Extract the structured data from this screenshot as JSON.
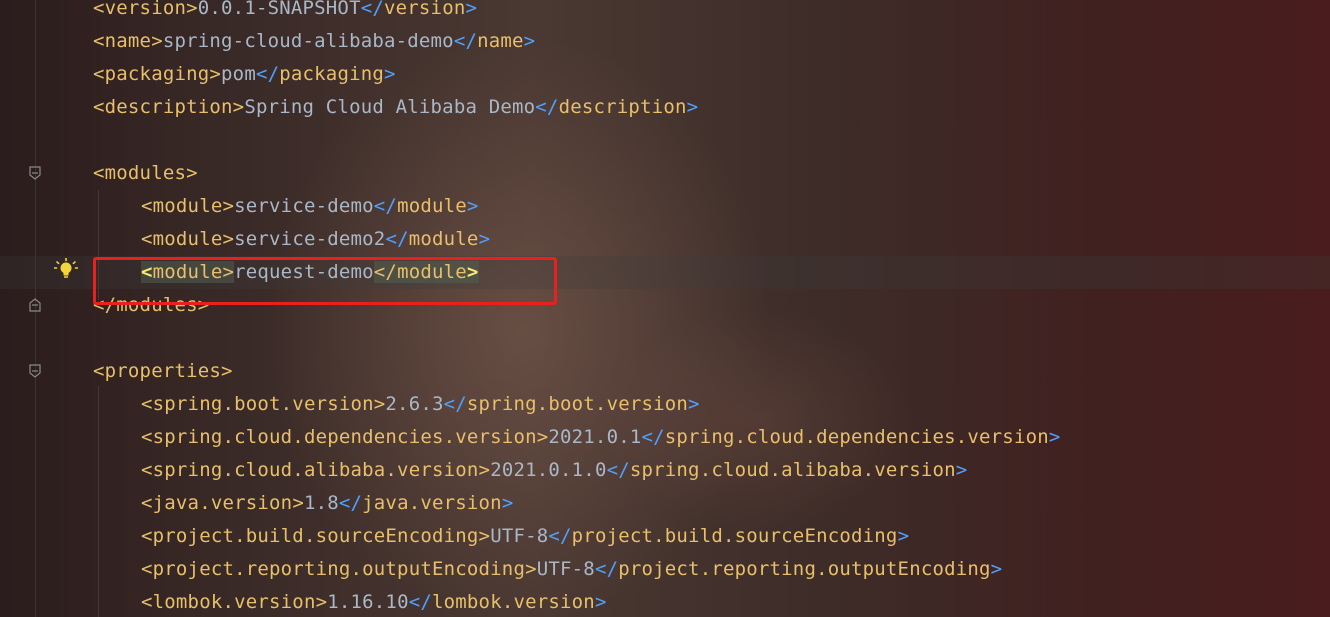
{
  "editor": {
    "file_type": "xml",
    "lines": [
      {
        "indent": 0,
        "open_tag": "version",
        "text": "0.0.1-SNAPSHOT",
        "close_tag": "version"
      },
      {
        "indent": 0,
        "open_tag": "name",
        "text": "spring-cloud-alibaba-demo",
        "close_tag": "name"
      },
      {
        "indent": 0,
        "open_tag": "packaging",
        "text": "pom",
        "close_tag": "packaging"
      },
      {
        "indent": 0,
        "open_tag": "description",
        "text": "Spring Cloud Alibaba Demo",
        "close_tag": "description"
      },
      {
        "indent": 0,
        "open_tag": "",
        "text": "",
        "close_tag": ""
      },
      {
        "indent": 0,
        "open_tag": "modules",
        "text": "",
        "close_tag": ""
      },
      {
        "indent": 1,
        "open_tag": "module",
        "text": "service-demo",
        "close_tag": "module"
      },
      {
        "indent": 1,
        "open_tag": "module",
        "text": "service-demo2",
        "close_tag": "module"
      },
      {
        "indent": 1,
        "open_tag": "module",
        "text": "request-demo",
        "close_tag": "module"
      },
      {
        "indent": 0,
        "open_tag": "",
        "text": "",
        "close_tag": "modules"
      },
      {
        "indent": 0,
        "open_tag": "",
        "text": "",
        "close_tag": ""
      },
      {
        "indent": 0,
        "open_tag": "properties",
        "text": "",
        "close_tag": ""
      },
      {
        "indent": 1,
        "open_tag": "spring.boot.version",
        "text": "2.6.3",
        "close_tag": "spring.boot.version"
      },
      {
        "indent": 1,
        "open_tag": "spring.cloud.dependencies.version",
        "text": "2021.0.1",
        "close_tag": "spring.cloud.dependencies.version"
      },
      {
        "indent": 1,
        "open_tag": "spring.cloud.alibaba.version",
        "text": "2021.0.1.0",
        "close_tag": "spring.cloud.alibaba.version"
      },
      {
        "indent": 1,
        "open_tag": "java.version",
        "text": "1.8",
        "close_tag": "java.version"
      },
      {
        "indent": 1,
        "open_tag": "project.build.sourceEncoding",
        "text": "UTF-8",
        "close_tag": "project.build.sourceEncoding"
      },
      {
        "indent": 1,
        "open_tag": "project.reporting.outputEncoding",
        "text": "UTF-8",
        "close_tag": "project.reporting.outputEncoding"
      },
      {
        "indent": 1,
        "open_tag": "lombok.version",
        "text": "1.16.10",
        "close_tag": "lombok.version"
      }
    ],
    "current_line_index": 8,
    "highlighted_line_index": 8,
    "fold_marker_lines": [
      5,
      9,
      11
    ],
    "intention_bulb_line": 8
  },
  "colors": {
    "tag": "#e8bf6a",
    "text": "#a9b7c6",
    "closing_bracket_match": "#4fa0ff",
    "highlight_box": "#e8201e",
    "bulb": "#f5d33b"
  },
  "icons": {
    "intention": "lightbulb-icon",
    "fold": "fold-marker-icon"
  }
}
